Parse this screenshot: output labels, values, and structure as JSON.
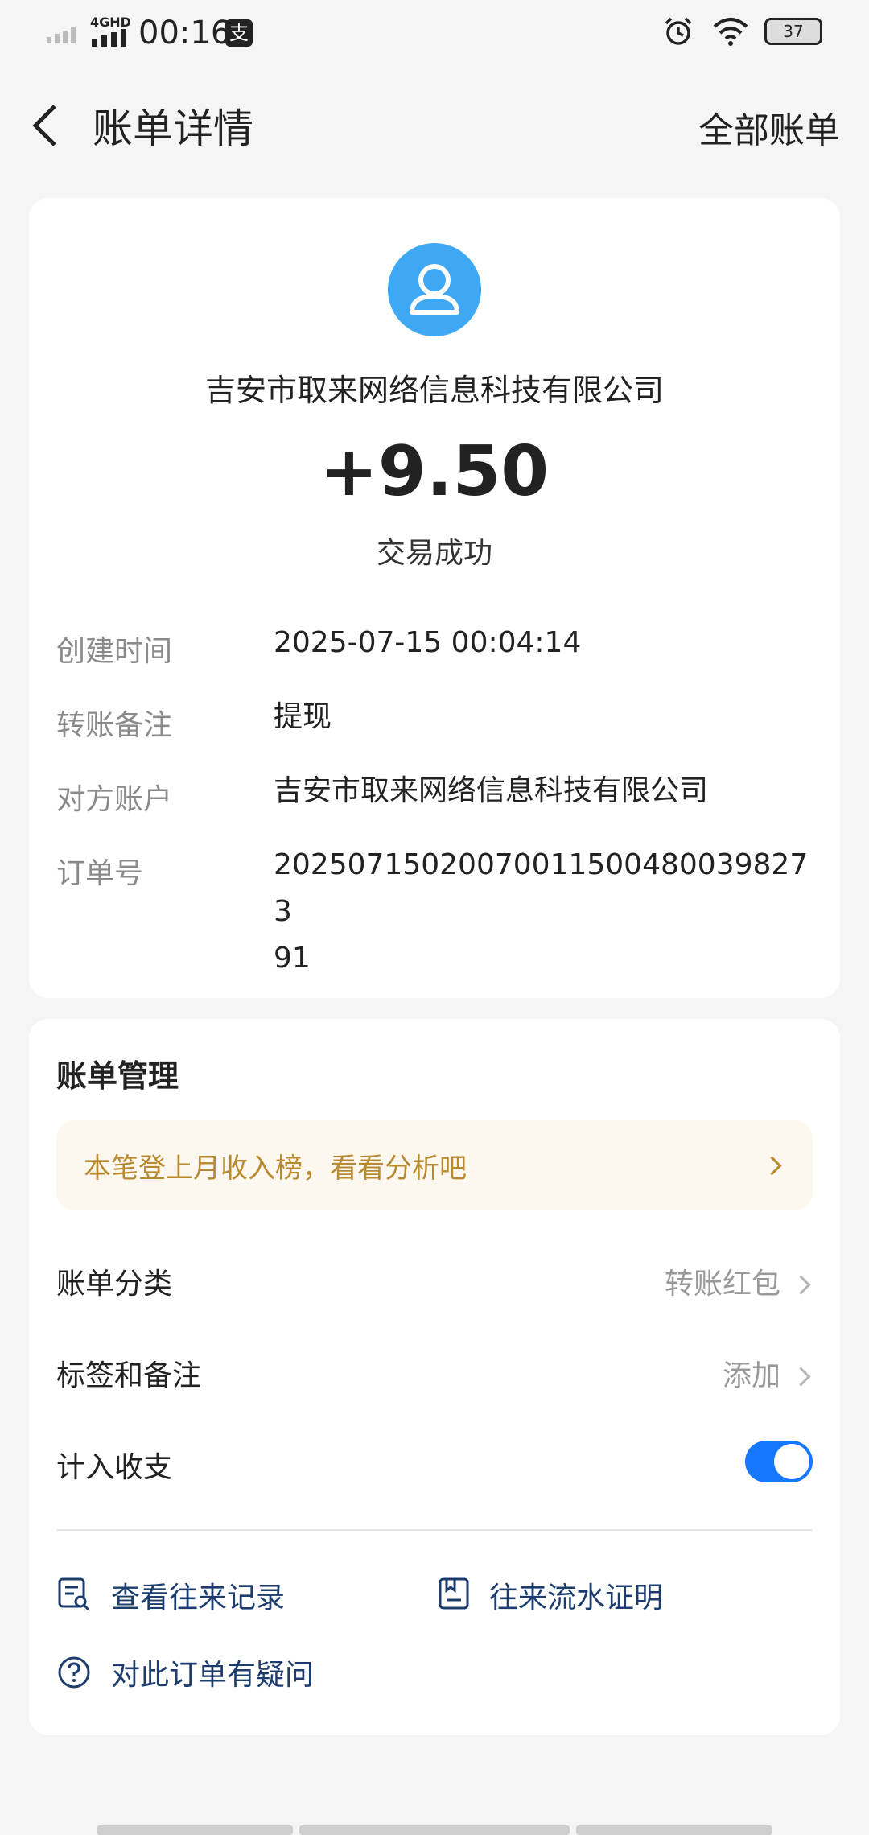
{
  "statusbar": {
    "network": "4GHD",
    "time": "00:16",
    "pay_glyph": "支",
    "battery": "37"
  },
  "nav": {
    "title": "账单详情",
    "right": "全部账单"
  },
  "bill": {
    "merchant": "吉安市取来网络信息科技有限公司",
    "amount": "+9.50",
    "status": "交易成功",
    "rows": [
      {
        "k": "创建时间",
        "v": "2025-07-15 00:04:14"
      },
      {
        "k": "转账备注",
        "v": "提现"
      },
      {
        "k": "对方账户",
        "v": "吉安市取来网络信息科技有限公司"
      },
      {
        "k": "订单号",
        "v": "2025071502007001150048003982739 1"
      }
    ]
  },
  "manage": {
    "title": "账单管理",
    "banner": "本笔登上月收入榜，看看分析吧",
    "category_label": "账单分类",
    "category_value": "转账红包",
    "tag_label": "标签和备注",
    "tag_value": "添加",
    "include_label": "计入收支",
    "include_on": true,
    "links": [
      "查看往来记录",
      "往来流水证明",
      "对此订单有疑问"
    ]
  },
  "colors": {
    "accent": "#1677ff",
    "avatar": "#3ea8f4",
    "banner_text": "#b88a30",
    "link": "#1d3c6e"
  },
  "icons": [
    "signal-icon",
    "wifi-icon",
    "alarm-icon",
    "back-icon",
    "user-icon",
    "chevron-right-icon",
    "record-icon",
    "statement-icon",
    "question-icon"
  ]
}
